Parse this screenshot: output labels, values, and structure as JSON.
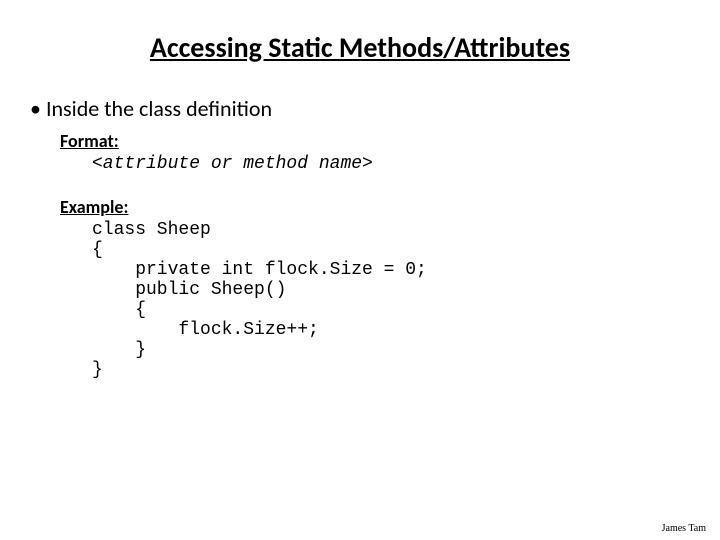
{
  "title": "Accessing Static Methods/Attributes",
  "bullet": "Inside the class definition",
  "format": {
    "label": "Format:",
    "line1": "<attribute or method name>"
  },
  "example": {
    "label": "Example:",
    "line1": "class Sheep",
    "line2": "{",
    "line3": "    private int flock.Size = 0;",
    "line4": "",
    "line5": "    public Sheep()",
    "line6": "    {",
    "line7": "        flock.Size++;",
    "line8": "    }",
    "line9": "}"
  },
  "footer": "James Tam"
}
